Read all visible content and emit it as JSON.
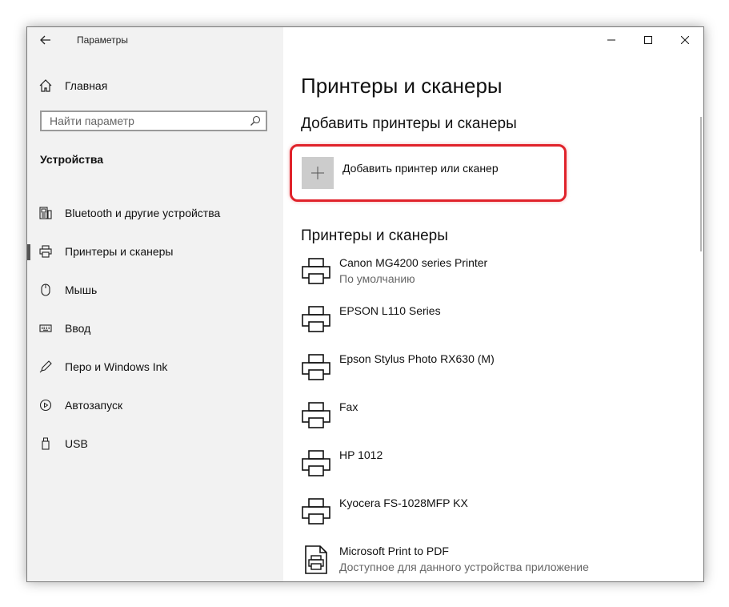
{
  "window": {
    "app_title": "Параметры"
  },
  "sidebar": {
    "home_label": "Главная",
    "search_placeholder": "Найти параметр",
    "section_heading": "Устройства",
    "items": [
      {
        "label": "Bluetooth и другие устройства",
        "icon": "bluetooth-devices-icon",
        "selected": false
      },
      {
        "label": "Принтеры и сканеры",
        "icon": "printer-icon",
        "selected": true
      },
      {
        "label": "Мышь",
        "icon": "mouse-icon",
        "selected": false
      },
      {
        "label": "Ввод",
        "icon": "keyboard-icon",
        "selected": false
      },
      {
        "label": "Перо и Windows Ink",
        "icon": "pen-icon",
        "selected": false
      },
      {
        "label": "Автозапуск",
        "icon": "autoplay-icon",
        "selected": false
      },
      {
        "label": "USB",
        "icon": "usb-icon",
        "selected": false
      }
    ]
  },
  "content": {
    "page_title": "Принтеры и сканеры",
    "add_section_heading": "Добавить принтеры и сканеры",
    "add_button_label": "Добавить принтер или сканер",
    "list_heading": "Принтеры и сканеры",
    "printers": [
      {
        "name": "Canon MG4200 series Printer",
        "status": "По умолчанию",
        "icon": "printer-icon"
      },
      {
        "name": "EPSON L110 Series",
        "status": "",
        "icon": "printer-icon"
      },
      {
        "name": "Epson Stylus Photo RX630 (M)",
        "status": "",
        "icon": "printer-icon"
      },
      {
        "name": "Fax",
        "status": "",
        "icon": "printer-icon"
      },
      {
        "name": "HP 1012",
        "status": "",
        "icon": "printer-icon"
      },
      {
        "name": "Kyocera FS-1028MFP KX",
        "status": "",
        "icon": "printer-icon"
      },
      {
        "name": "Microsoft Print to PDF",
        "status": "Доступное для данного устройства приложение",
        "icon": "print-to-pdf-icon"
      }
    ]
  },
  "colors": {
    "sidebar_bg": "#f2f2f2",
    "highlight": "#e0222a",
    "add_tile": "#cccccc"
  }
}
